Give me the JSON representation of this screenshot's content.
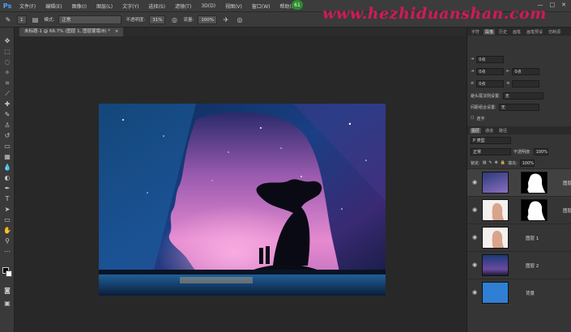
{
  "app": {
    "logo": "Ps",
    "menu": [
      "文件(F)",
      "编辑(E)",
      "图像(I)",
      "图层(L)",
      "文字(Y)",
      "选择(S)",
      "滤镜(T)",
      "3D(D)",
      "视图(V)",
      "窗口(W)",
      "帮助(H)"
    ],
    "badge": "61",
    "window_buttons": [
      "—",
      "□",
      "✕"
    ]
  },
  "watermark": "www.hezhiduanshan.com",
  "options": {
    "brush_size": "1",
    "mode_label": "模式:",
    "mode_value": "正常",
    "opacity_label": "不透明度:",
    "opacity_value": "31%",
    "flow_label": "流量:",
    "flow_value": "100%"
  },
  "document": {
    "tab_title": "未标题-1 @ 66.7% (图层 1, 图层蒙版/8) *",
    "tab_close": "×"
  },
  "panel": {
    "top_tabs": [
      "字符",
      "段落",
      "历史",
      "画笔",
      "画笔预设",
      "仿制源"
    ],
    "char_fields": [
      "0点",
      "0点",
      "0点",
      "0点"
    ],
    "indent1_label": "避头尾法则设置:",
    "indent1_value": "无",
    "indent2_label": "间距组合设置:",
    "indent2_value": "无",
    "hyphen_label": "连字",
    "layer_tabs": [
      "图层",
      "通道",
      "路径"
    ],
    "kind": "P 类型",
    "blend_mode": "正常",
    "opacity_label": "不透明度:",
    "opacity_value": "100%",
    "lock_label": "锁定:",
    "fill_label": "填充:",
    "fill_value": "100%",
    "layers": [
      {
        "name": "图层",
        "selected": true
      },
      {
        "name": "图层",
        "selected": false
      },
      {
        "name": "图层 1",
        "selected": false
      },
      {
        "name": "图层 2",
        "selected": false
      },
      {
        "name": "背景",
        "selected": false
      }
    ]
  },
  "colors": {
    "accent_blue": "#2f7fd4",
    "watermark": "#e0185a"
  }
}
